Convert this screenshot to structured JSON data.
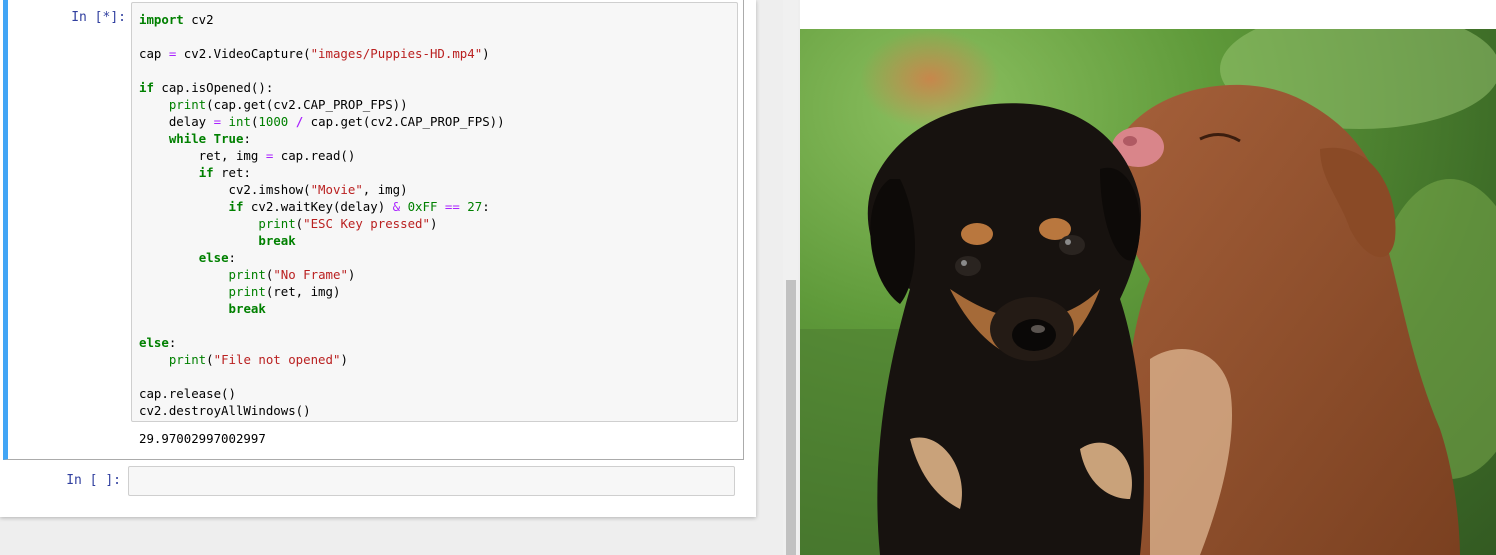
{
  "cells": [
    {
      "prompt": "In [*]:",
      "code": [
        [
          [
            "kw",
            "import"
          ],
          [
            "t",
            " cv2"
          ]
        ],
        [],
        [
          [
            "t",
            "cap "
          ],
          [
            "op",
            "="
          ],
          [
            "t",
            " cv2.VideoCapture("
          ],
          [
            "st",
            "\"images/Puppies-HD.mp4\""
          ],
          [
            "t",
            ")"
          ]
        ],
        [],
        [
          [
            "kw",
            "if"
          ],
          [
            "t",
            " cap.isOpened():"
          ]
        ],
        [
          [
            "t",
            "    "
          ],
          [
            "bi",
            "print"
          ],
          [
            "t",
            "(cap.get(cv2.CAP_PROP_FPS))"
          ]
        ],
        [
          [
            "t",
            "    delay "
          ],
          [
            "op",
            "="
          ],
          [
            "t",
            " "
          ],
          [
            "bi",
            "int"
          ],
          [
            "t",
            "("
          ],
          [
            "nu",
            "1000"
          ],
          [
            "t",
            " "
          ],
          [
            "opb",
            "/"
          ],
          [
            "t",
            " cap.get(cv2.CAP_PROP_FPS))"
          ]
        ],
        [
          [
            "t",
            "    "
          ],
          [
            "kw",
            "while"
          ],
          [
            "t",
            " "
          ],
          [
            "kw",
            "True"
          ],
          [
            "t",
            ":"
          ]
        ],
        [
          [
            "t",
            "        ret, img "
          ],
          [
            "op",
            "="
          ],
          [
            "t",
            " cap.read()"
          ]
        ],
        [
          [
            "t",
            "        "
          ],
          [
            "kw",
            "if"
          ],
          [
            "t",
            " ret:"
          ]
        ],
        [
          [
            "t",
            "            cv2.imshow("
          ],
          [
            "st",
            "\"Movie\""
          ],
          [
            "t",
            ", img)"
          ]
        ],
        [
          [
            "t",
            "            "
          ],
          [
            "kw",
            "if"
          ],
          [
            "t",
            " cv2.waitKey(delay) "
          ],
          [
            "op",
            "&"
          ],
          [
            "t",
            " "
          ],
          [
            "nu",
            "0xFF"
          ],
          [
            "t",
            " "
          ],
          [
            "op",
            "=="
          ],
          [
            "t",
            " "
          ],
          [
            "nu",
            "27"
          ],
          [
            "t",
            ":"
          ]
        ],
        [
          [
            "t",
            "                "
          ],
          [
            "bi",
            "print"
          ],
          [
            "t",
            "("
          ],
          [
            "st",
            "\"ESC Key pressed\""
          ],
          [
            "t",
            ")"
          ]
        ],
        [
          [
            "t",
            "                "
          ],
          [
            "kw",
            "break"
          ]
        ],
        [
          [
            "t",
            "        "
          ],
          [
            "kw",
            "else"
          ],
          [
            "t",
            ":"
          ]
        ],
        [
          [
            "t",
            "            "
          ],
          [
            "bi",
            "print"
          ],
          [
            "t",
            "("
          ],
          [
            "st",
            "\"No Frame\""
          ],
          [
            "t",
            ")"
          ]
        ],
        [
          [
            "t",
            "            "
          ],
          [
            "bi",
            "print"
          ],
          [
            "t",
            "(ret, img)"
          ]
        ],
        [
          [
            "t",
            "            "
          ],
          [
            "kw",
            "break"
          ]
        ],
        [],
        [
          [
            "kw",
            "else"
          ],
          [
            "t",
            ":"
          ]
        ],
        [
          [
            "t",
            "    "
          ],
          [
            "bi",
            "print"
          ],
          [
            "t",
            "("
          ],
          [
            "st",
            "\"File not opened\""
          ],
          [
            "t",
            ")"
          ]
        ],
        [],
        [
          [
            "t",
            "cap.release()"
          ]
        ],
        [
          [
            "t",
            "cv2.destroyAllWindows()"
          ]
        ]
      ],
      "output": "29.97002997002997"
    },
    {
      "prompt": "In [ ]:",
      "code": []
    }
  ],
  "colors": {
    "active_cell_border": "#42a5f5",
    "prompt_color": "#303f9f",
    "keyword": "#008000",
    "string": "#ba2121",
    "operator": "#aa22ff"
  },
  "movie_window": {
    "frame_content": "two puppies (black-and-tan and brown) on grass background"
  }
}
